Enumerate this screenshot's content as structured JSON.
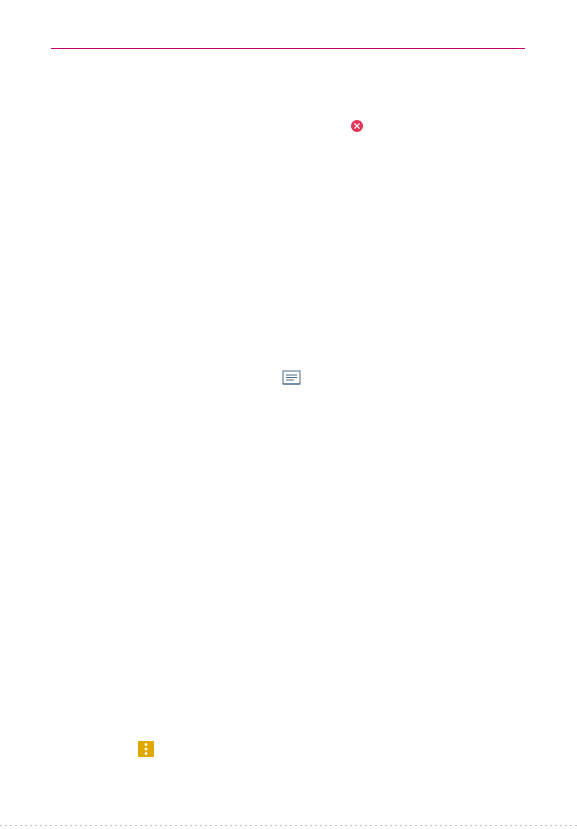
{
  "page": {
    "accent_color": "#c0007a",
    "icons": {
      "delete": {
        "name": "delete-circle-icon",
        "color": "#e3365b"
      },
      "message": {
        "name": "message-icon",
        "color": "#4a6b8a"
      },
      "menu": {
        "name": "more-options-icon",
        "color": "#e0a800"
      }
    }
  }
}
